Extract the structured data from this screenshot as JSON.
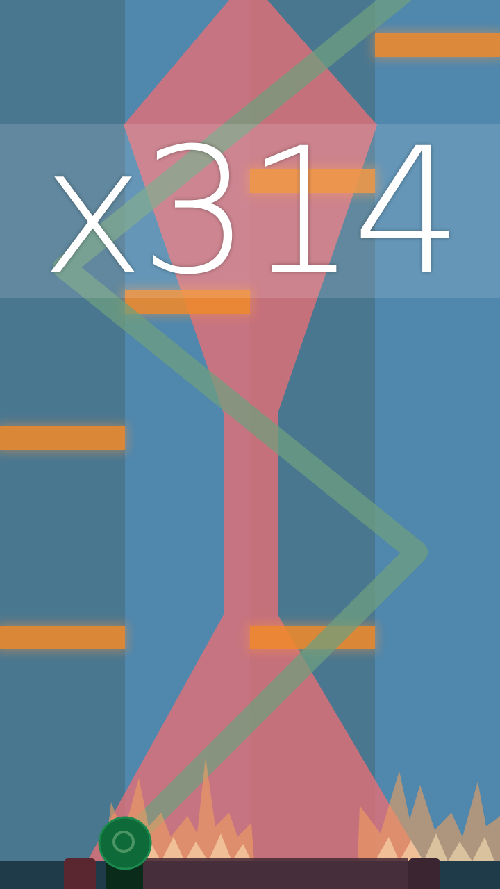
{
  "hud": {
    "multiplier": "x314"
  },
  "colors": {
    "lane_dark": "#4a7790",
    "lane_light": "#4f87ad",
    "platform": "#f08a2c",
    "beam": "#d9707e",
    "trail": "#6fa07e",
    "player": "#0f6a3a",
    "ground": "#1f3a48",
    "spikes": "#f0a060"
  },
  "icons": {
    "player": "green-ball-icon",
    "hazard": "fire-spikes-icon"
  }
}
